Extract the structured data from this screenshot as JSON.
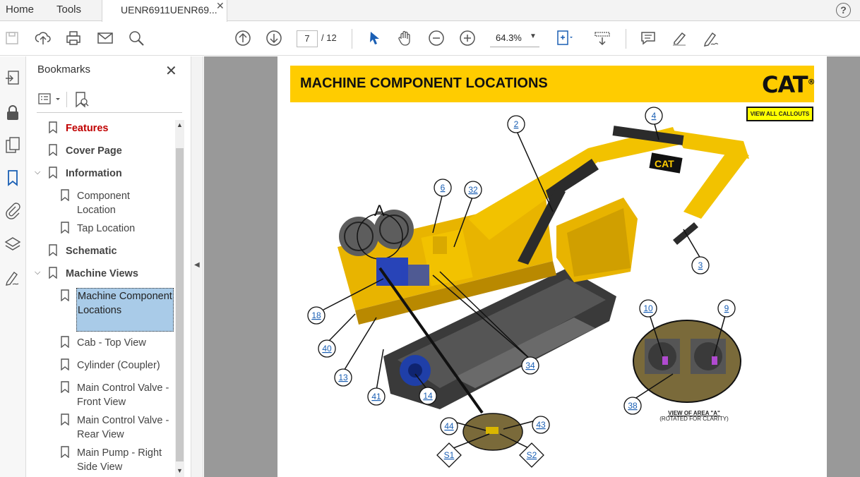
{
  "tabs": {
    "home": "Home",
    "tools": "Tools",
    "document": "UENR6911UENR69...",
    "close": "✕"
  },
  "help": "?",
  "toolbar": {
    "page_current": "7",
    "page_sep": "/",
    "page_total": "12",
    "zoom": "64.3%"
  },
  "bookmarks": {
    "title": "Bookmarks",
    "items": [
      {
        "label": "Features"
      },
      {
        "label": "Cover Page"
      },
      {
        "label": "Information"
      },
      {
        "label": "Component Location"
      },
      {
        "label": "Tap Location"
      },
      {
        "label": "Schematic"
      },
      {
        "label": "Machine Views"
      },
      {
        "label": "Machine Component Locations"
      },
      {
        "label": "Cab - Top View"
      },
      {
        "label": "Cylinder (Coupler)"
      },
      {
        "label": "Main Control Valve - Front View"
      },
      {
        "label": "Main Control Valve - Rear View"
      },
      {
        "label": "Main Pump - Right Side View"
      }
    ]
  },
  "document": {
    "title": "MACHINE COMPONENT LOCATIONS",
    "logo": "CAT",
    "logo_mark": "®",
    "view_all": "VIEW ALL CALLOUTS",
    "area_letter": "A",
    "view_caption": "VIEW OF AREA \"A\"",
    "view_caption_sub": "(ROTATED FOR CLARITY)",
    "boom_logo": "CAT",
    "callouts": [
      "2",
      "4",
      "6",
      "32",
      "3",
      "18",
      "40",
      "13",
      "41",
      "14",
      "34",
      "10",
      "9",
      "38",
      "44",
      "43"
    ],
    "test_points": [
      "S1",
      "S2"
    ]
  },
  "colors": {
    "banner": "#ffcc00",
    "selection": "#a9cbe8",
    "callout": "#1a5fb4",
    "features": "#c00000"
  }
}
